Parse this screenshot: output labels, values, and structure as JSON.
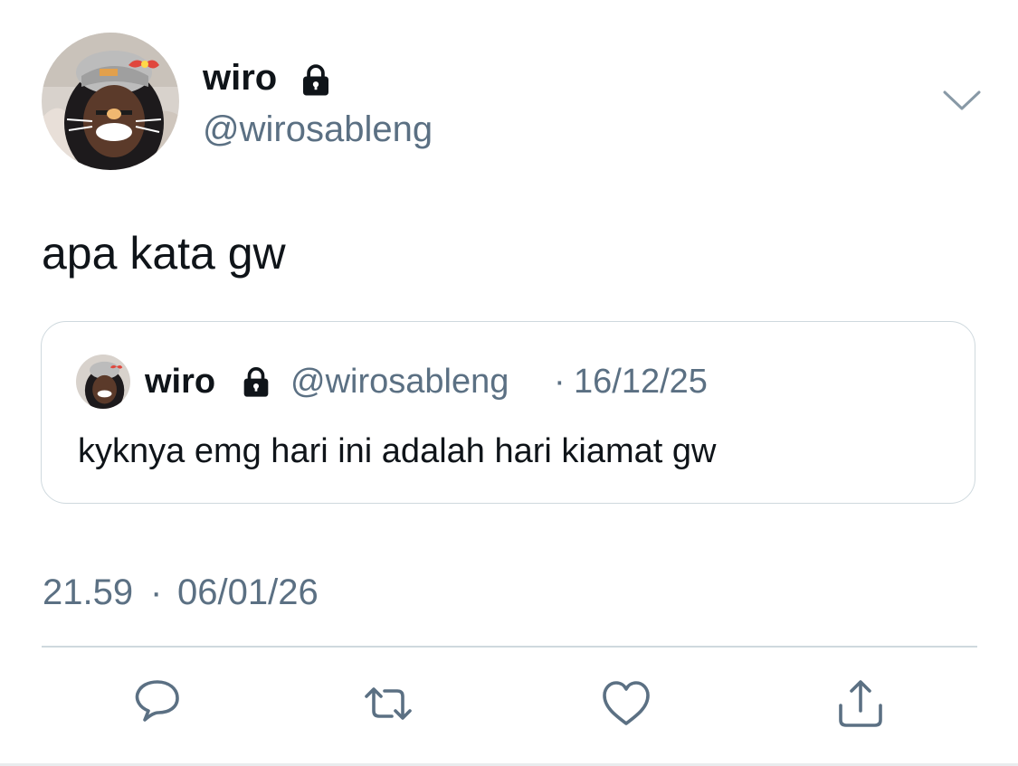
{
  "tweet": {
    "author": {
      "name": "wiro",
      "handle": "@wirosableng",
      "protected_icon": "lock-icon"
    },
    "menu_icon": "chevron-down-icon",
    "text": "apa kata gw",
    "quoted": {
      "author": {
        "name": "wiro",
        "handle": "@wirosableng",
        "protected_icon": "lock-icon"
      },
      "separator": "·",
      "date": "16/12/25",
      "text": "kyknya emg hari ini adalah hari kiamat gw"
    },
    "meta": {
      "time": "21.59",
      "separator": "·",
      "date": "06/01/26"
    },
    "actions": [
      "reply-icon",
      "retweet-icon",
      "like-icon",
      "share-icon"
    ]
  },
  "colors": {
    "text_primary": "#0f1419",
    "text_secondary": "#5b7083",
    "border": "#cfd9de",
    "icon": "#5b7083"
  }
}
